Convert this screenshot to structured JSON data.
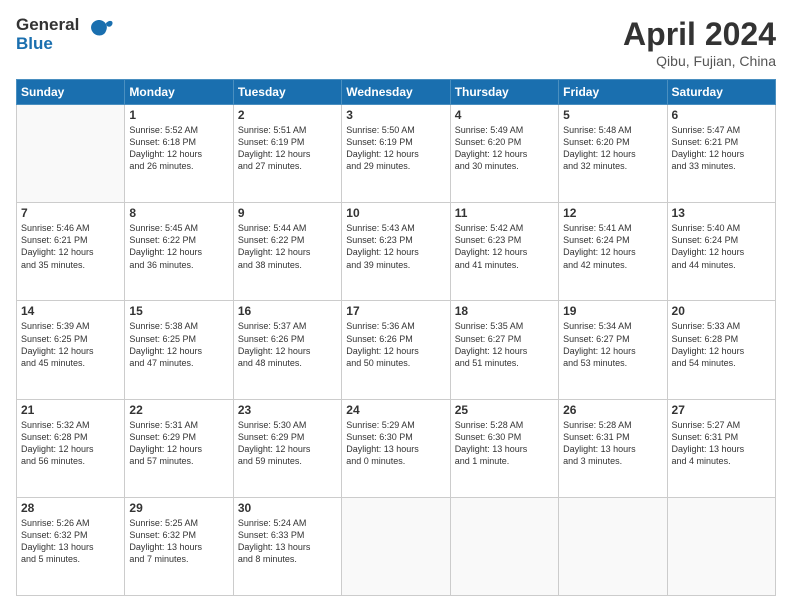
{
  "logo": {
    "general": "General",
    "blue": "Blue"
  },
  "title": "April 2024",
  "subtitle": "Qibu, Fujian, China",
  "weekdays": [
    "Sunday",
    "Monday",
    "Tuesday",
    "Wednesday",
    "Thursday",
    "Friday",
    "Saturday"
  ],
  "weeks": [
    [
      {
        "day": "",
        "info": ""
      },
      {
        "day": "1",
        "info": "Sunrise: 5:52 AM\nSunset: 6:18 PM\nDaylight: 12 hours\nand 26 minutes."
      },
      {
        "day": "2",
        "info": "Sunrise: 5:51 AM\nSunset: 6:19 PM\nDaylight: 12 hours\nand 27 minutes."
      },
      {
        "day": "3",
        "info": "Sunrise: 5:50 AM\nSunset: 6:19 PM\nDaylight: 12 hours\nand 29 minutes."
      },
      {
        "day": "4",
        "info": "Sunrise: 5:49 AM\nSunset: 6:20 PM\nDaylight: 12 hours\nand 30 minutes."
      },
      {
        "day": "5",
        "info": "Sunrise: 5:48 AM\nSunset: 6:20 PM\nDaylight: 12 hours\nand 32 minutes."
      },
      {
        "day": "6",
        "info": "Sunrise: 5:47 AM\nSunset: 6:21 PM\nDaylight: 12 hours\nand 33 minutes."
      }
    ],
    [
      {
        "day": "7",
        "info": "Sunrise: 5:46 AM\nSunset: 6:21 PM\nDaylight: 12 hours\nand 35 minutes."
      },
      {
        "day": "8",
        "info": "Sunrise: 5:45 AM\nSunset: 6:22 PM\nDaylight: 12 hours\nand 36 minutes."
      },
      {
        "day": "9",
        "info": "Sunrise: 5:44 AM\nSunset: 6:22 PM\nDaylight: 12 hours\nand 38 minutes."
      },
      {
        "day": "10",
        "info": "Sunrise: 5:43 AM\nSunset: 6:23 PM\nDaylight: 12 hours\nand 39 minutes."
      },
      {
        "day": "11",
        "info": "Sunrise: 5:42 AM\nSunset: 6:23 PM\nDaylight: 12 hours\nand 41 minutes."
      },
      {
        "day": "12",
        "info": "Sunrise: 5:41 AM\nSunset: 6:24 PM\nDaylight: 12 hours\nand 42 minutes."
      },
      {
        "day": "13",
        "info": "Sunrise: 5:40 AM\nSunset: 6:24 PM\nDaylight: 12 hours\nand 44 minutes."
      }
    ],
    [
      {
        "day": "14",
        "info": "Sunrise: 5:39 AM\nSunset: 6:25 PM\nDaylight: 12 hours\nand 45 minutes."
      },
      {
        "day": "15",
        "info": "Sunrise: 5:38 AM\nSunset: 6:25 PM\nDaylight: 12 hours\nand 47 minutes."
      },
      {
        "day": "16",
        "info": "Sunrise: 5:37 AM\nSunset: 6:26 PM\nDaylight: 12 hours\nand 48 minutes."
      },
      {
        "day": "17",
        "info": "Sunrise: 5:36 AM\nSunset: 6:26 PM\nDaylight: 12 hours\nand 50 minutes."
      },
      {
        "day": "18",
        "info": "Sunrise: 5:35 AM\nSunset: 6:27 PM\nDaylight: 12 hours\nand 51 minutes."
      },
      {
        "day": "19",
        "info": "Sunrise: 5:34 AM\nSunset: 6:27 PM\nDaylight: 12 hours\nand 53 minutes."
      },
      {
        "day": "20",
        "info": "Sunrise: 5:33 AM\nSunset: 6:28 PM\nDaylight: 12 hours\nand 54 minutes."
      }
    ],
    [
      {
        "day": "21",
        "info": "Sunrise: 5:32 AM\nSunset: 6:28 PM\nDaylight: 12 hours\nand 56 minutes."
      },
      {
        "day": "22",
        "info": "Sunrise: 5:31 AM\nSunset: 6:29 PM\nDaylight: 12 hours\nand 57 minutes."
      },
      {
        "day": "23",
        "info": "Sunrise: 5:30 AM\nSunset: 6:29 PM\nDaylight: 12 hours\nand 59 minutes."
      },
      {
        "day": "24",
        "info": "Sunrise: 5:29 AM\nSunset: 6:30 PM\nDaylight: 13 hours\nand 0 minutes."
      },
      {
        "day": "25",
        "info": "Sunrise: 5:28 AM\nSunset: 6:30 PM\nDaylight: 13 hours\nand 1 minute."
      },
      {
        "day": "26",
        "info": "Sunrise: 5:28 AM\nSunset: 6:31 PM\nDaylight: 13 hours\nand 3 minutes."
      },
      {
        "day": "27",
        "info": "Sunrise: 5:27 AM\nSunset: 6:31 PM\nDaylight: 13 hours\nand 4 minutes."
      }
    ],
    [
      {
        "day": "28",
        "info": "Sunrise: 5:26 AM\nSunset: 6:32 PM\nDaylight: 13 hours\nand 5 minutes."
      },
      {
        "day": "29",
        "info": "Sunrise: 5:25 AM\nSunset: 6:32 PM\nDaylight: 13 hours\nand 7 minutes."
      },
      {
        "day": "30",
        "info": "Sunrise: 5:24 AM\nSunset: 6:33 PM\nDaylight: 13 hours\nand 8 minutes."
      },
      {
        "day": "",
        "info": ""
      },
      {
        "day": "",
        "info": ""
      },
      {
        "day": "",
        "info": ""
      },
      {
        "day": "",
        "info": ""
      }
    ]
  ]
}
